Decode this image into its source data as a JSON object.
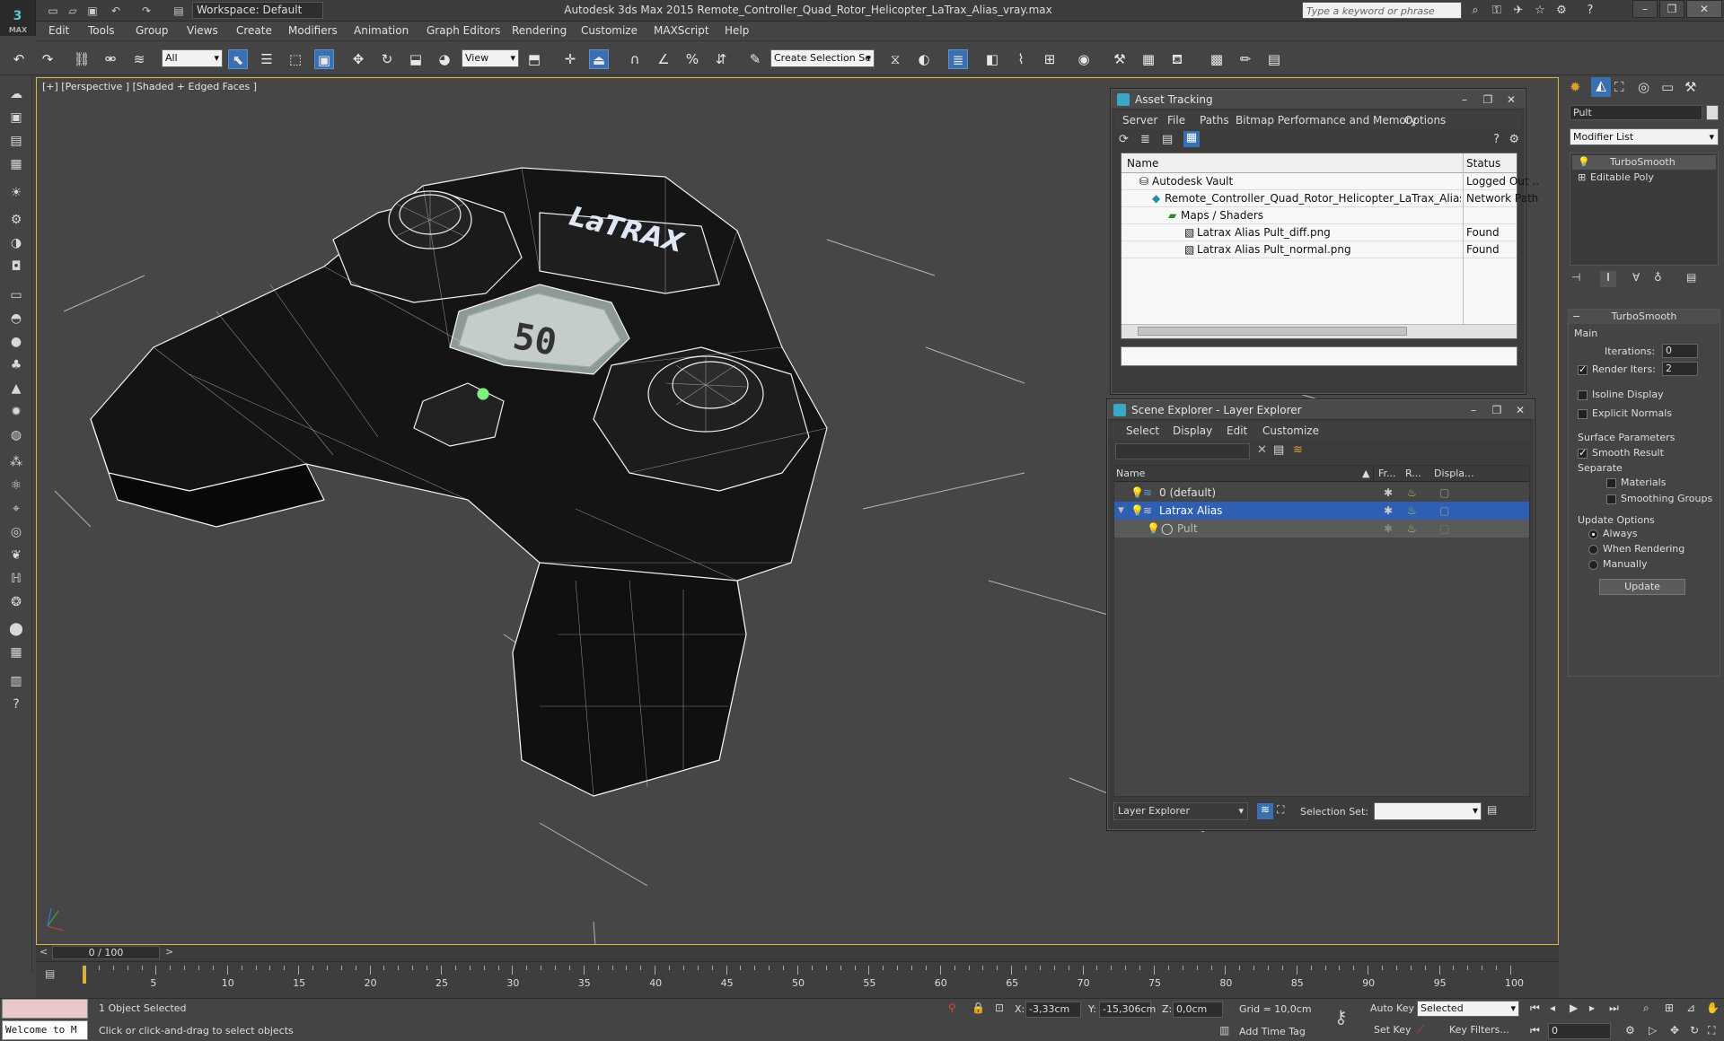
{
  "app": {
    "title": "Autodesk 3ds Max 2015     Remote_Controller_Quad_Rotor_Helicopter_LaTrax_Alias_vray.max",
    "logo": "3",
    "logo_sub": "MAX",
    "workspace": "Workspace: Default",
    "search_placeholder": "Type a keyword or phrase"
  },
  "menu": [
    "Edit",
    "Tools",
    "Group",
    "Views",
    "Create",
    "Modifiers",
    "Animation",
    "Graph Editors",
    "Rendering",
    "Customize",
    "MAXScript",
    "Help"
  ],
  "toolbar": {
    "selection_filter": "All",
    "ref_coord": "View",
    "named_selection": "Create Selection Se"
  },
  "viewport": {
    "label": "[+] [Perspective ] [Shaded + Edged Faces ]",
    "lcd_text": "50",
    "brand_text": "LaTRAX"
  },
  "asset_tracking": {
    "title": "Asset Tracking",
    "menu": [
      "Server",
      "File",
      "Paths",
      "Bitmap Performance and Memory",
      "Options"
    ],
    "col_name": "Name",
    "col_status": "Status",
    "rows": [
      {
        "name": "Autodesk Vault",
        "status": "Logged Out ..",
        "indent": 1
      },
      {
        "name": "Remote_Controller_Quad_Rotor_Helicopter_LaTrax_Alias_vr...",
        "status": "Network Path",
        "indent": 2
      },
      {
        "name": "Maps / Shaders",
        "status": "",
        "indent": 3
      },
      {
        "name": "Latrax Alias Pult_diff.png",
        "status": "Found",
        "indent": 4
      },
      {
        "name": "Latrax Alias Pult_normal.png",
        "status": "Found",
        "indent": 4
      }
    ]
  },
  "scene_explorer": {
    "title": "Scene Explorer - Layer Explorer",
    "menu": [
      "Select",
      "Display",
      "Edit",
      "Customize"
    ],
    "col_name": "Name",
    "col_fr": "Fr...",
    "col_r": "R...",
    "col_disp": "Displa...",
    "rows": [
      {
        "name": "0 (default)",
        "indent": 0,
        "selected": false
      },
      {
        "name": "Latrax Alias",
        "indent": 0,
        "selected": true
      },
      {
        "name": "Pult",
        "indent": 1,
        "selected": false
      }
    ],
    "footer_mode": "Layer Explorer",
    "selection_set_label": "Selection Set:"
  },
  "command_panel": {
    "object_name": "Pult",
    "modifier_list": "Modifier List",
    "stack": [
      "TurboSmooth",
      "Editable Poly"
    ],
    "rollout_title": "TurboSmooth",
    "main_label": "Main",
    "iterations_label": "Iterations:",
    "iterations": "0",
    "render_iters_label": "Render Iters:",
    "render_iters": "2",
    "isoline": "Isoline Display",
    "explicit_normals": "Explicit Normals",
    "surface_params": "Surface Parameters",
    "smooth_result": "Smooth Result",
    "separate": "Separate",
    "materials": "Materials",
    "smoothing_groups": "Smoothing Groups",
    "update_options": "Update Options",
    "always": "Always",
    "when_rendering": "When Rendering",
    "manually": "Manually",
    "update_btn": "Update"
  },
  "timeline": {
    "frame_display": "0 / 100",
    "ticks": [
      "5",
      "10",
      "15",
      "20",
      "25",
      "30",
      "35",
      "40",
      "45",
      "50",
      "55",
      "60",
      "65",
      "70",
      "75",
      "80",
      "85",
      "90",
      "95",
      "100"
    ]
  },
  "status": {
    "maxscript": "Welcome to M",
    "selected": "1 Object Selected",
    "prompt": "Click or click-and-drag to select objects",
    "x_label": "X:",
    "x": "-3,33cm",
    "y_label": "Y:",
    "y": "-15,306cm",
    "z_label": "Z:",
    "z": "0,0cm",
    "grid": "Grid = 10,0cm",
    "add_time_tag": "Add Time Tag",
    "auto_key": "Auto Key",
    "set_key": "Set Key",
    "key_mode": "Selected",
    "key_filters": "Key Filters...",
    "frame": "0"
  }
}
